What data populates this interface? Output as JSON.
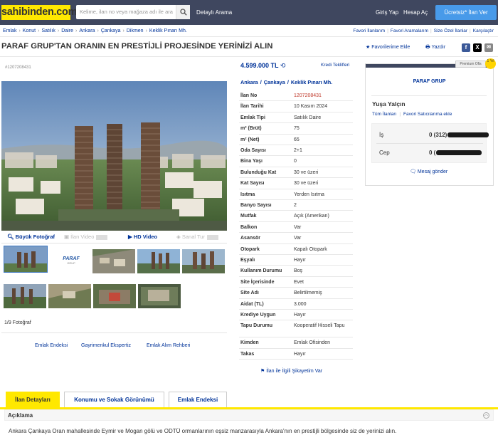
{
  "header": {
    "logo": "sahibinden.com",
    "search_placeholder": "Kelime, ilan no veya mağaza adı ile ara",
    "advanced_search": "Detaylı Arama",
    "login": "Giriş Yap",
    "register": "Hesap Aç",
    "post_ad": "Ücretsiz* İlan Ver"
  },
  "breadcrumbs": [
    "Emlak",
    "Konut",
    "Satılık",
    "Daire",
    "Ankara",
    "Çankaya",
    "Dikmen",
    "Keklik Pınarı Mh."
  ],
  "fav_links": [
    "Favori İlanlarım",
    "Favori Aramalarım",
    "Size Özel İlanlar",
    "Karşılaştır"
  ],
  "listing": {
    "title": "PARAF GRUP'TAN ORANIN EN PRESTİJLİ PROJESİNDE YERİNİZİ ALIN",
    "add_favorites": "Favorilerime Ekle",
    "print": "Yazdır",
    "ad_number_tag": "#1207208431",
    "price": "4.599.000 TL",
    "credit_offers": "Kredi Teklifleri",
    "location": [
      "Ankara",
      "Çankaya",
      "Keklik Pınarı Mh."
    ]
  },
  "media_tools": {
    "big_photo": "Büyük Fotoğraf",
    "ad_video": "İlan Video",
    "hd_video": "HD Video",
    "virtual_tour": "Sanal Tur",
    "photo_count": "1/9 Fotoğraf"
  },
  "bottom_links": [
    "Emlak Endeksi",
    "Gayrimenkul Ekspertiz",
    "Emlak Alım Rehberi"
  ],
  "details": [
    {
      "key": "İlan No",
      "value": "1207208431",
      "highlight": true
    },
    {
      "key": "İlan Tarihi",
      "value": "10 Kasım 2024"
    },
    {
      "key": "Emlak Tipi",
      "value": "Satılık Daire"
    },
    {
      "key": "m² (Brüt)",
      "value": "75"
    },
    {
      "key": "m² (Net)",
      "value": "65"
    },
    {
      "key": "Oda Sayısı",
      "value": "2+1"
    },
    {
      "key": "Bina Yaşı",
      "value": "0"
    },
    {
      "key": "Bulunduğu Kat",
      "value": "30 ve üzeri"
    },
    {
      "key": "Kat Sayısı",
      "value": "30 ve üzeri"
    },
    {
      "key": "Isıtma",
      "value": "Yerden Isıtma"
    },
    {
      "key": "Banyo Sayısı",
      "value": "2"
    },
    {
      "key": "Mutfak",
      "value": "Açık (Amerikan)"
    },
    {
      "key": "Balkon",
      "value": "Var"
    },
    {
      "key": "Asansör",
      "value": "Var"
    },
    {
      "key": "Otopark",
      "value": "Kapalı Otopark"
    },
    {
      "key": "Eşyalı",
      "value": "Hayır"
    },
    {
      "key": "Kullanım Durumu",
      "value": "Boş"
    },
    {
      "key": "Site İçerisinde",
      "value": "Evet"
    },
    {
      "key": "Site Adı",
      "value": "Belirtilmemiş"
    },
    {
      "key": "Aidat (TL)",
      "value": "3.000"
    },
    {
      "key": "Krediye Uygun",
      "value": "Hayır"
    },
    {
      "key": "Tapu Durumu",
      "value": "Kooperatif Hisseli Tapu"
    },
    {
      "key": "Kimden",
      "value": "Emlak Ofisinden"
    },
    {
      "key": "Takas",
      "value": "Hayır"
    }
  ],
  "complain": "İlan ile İlgili Şikayetim Var",
  "seller": {
    "premium_label": "Premium Ofis",
    "badge": "1 Yıl",
    "firm": "PARAF GRUP",
    "name": "Yuşa Yalçın",
    "all_ads": "Tüm İlanları",
    "fav_seller": "Favori Satıcılarıma ekle",
    "work_label": "İş",
    "work_value": "0 (312)",
    "mobile_label": "Cep",
    "mobile_value": "0 (",
    "send_message": "Mesaj gönder",
    "thumb_logo": "PARAF",
    "thumb_logo_sub": "GRUP"
  },
  "tabs": [
    "İlan Detayları",
    "Konumu ve Sokak Görünümü",
    "Emlak Endeksi"
  ],
  "description": {
    "title": "Açıklama",
    "text": "Ankara Çankaya Oran mahallesinde Eymir ve Mogan gölü ve ODTÜ ormanlarının eşsiz manzarasıyla Ankara'nın en prestijli bölgesinde siz de yerinizi alın."
  },
  "colors": {
    "navy": "#3f475f",
    "yellow": "#ffe800",
    "link": "#003399",
    "post": "#489ae9"
  }
}
